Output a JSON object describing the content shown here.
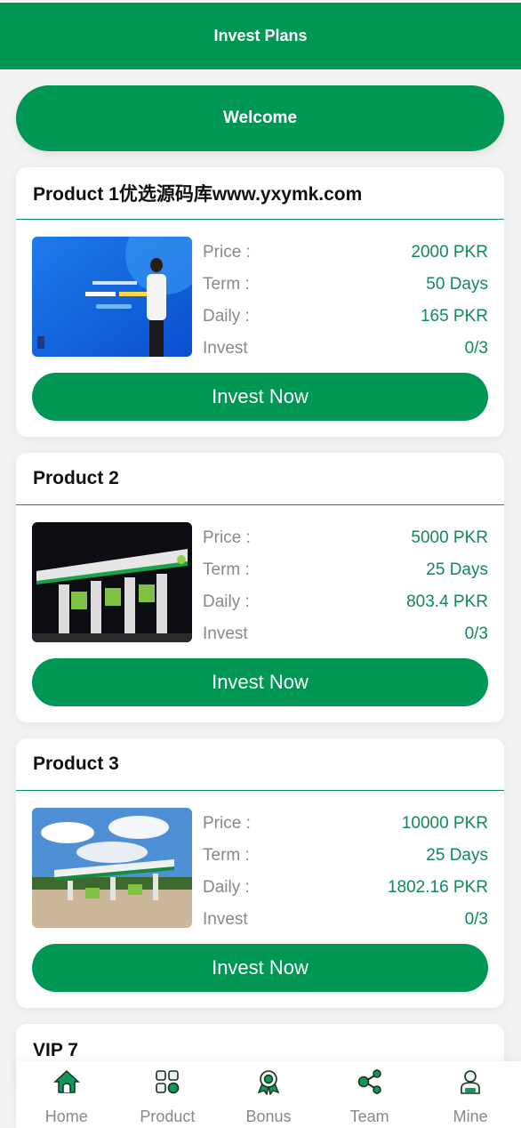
{
  "header": {
    "title": "Invest Plans"
  },
  "welcome_button": {
    "label": "Welcome"
  },
  "products": [
    {
      "title": "Product 1优选源码库www.yxymk.com",
      "image": "promo-banner-woman",
      "price_label": "Price :",
      "price_value": "2000 PKR",
      "term_label": "Term :",
      "term_value": "50 Days",
      "daily_label": "Daily :",
      "daily_value": "165 PKR",
      "invest_label": "Invest",
      "invest_value": "0/3",
      "button": "Invest Now"
    },
    {
      "title": "Product 2",
      "image": "gas-station-night",
      "price_label": "Price :",
      "price_value": "5000 PKR",
      "term_label": "Term :",
      "term_value": "25 Days",
      "daily_label": "Daily :",
      "daily_value": "803.4 PKR",
      "invest_label": "Invest",
      "invest_value": "0/3",
      "button": "Invest Now"
    },
    {
      "title": "Product 3",
      "image": "gas-station-day",
      "price_label": "Price :",
      "price_value": "10000 PKR",
      "term_label": "Term :",
      "term_value": "25 Days",
      "daily_label": "Daily :",
      "daily_value": "1802.16 PKR",
      "invest_label": "Invest",
      "invest_value": "0/3",
      "button": "Invest Now"
    },
    {
      "title": "VIP 7"
    }
  ],
  "tabbar": [
    {
      "label": "Home",
      "icon": "home-icon"
    },
    {
      "label": "Product",
      "icon": "grid-icon"
    },
    {
      "label": "Bonus",
      "icon": "award-icon"
    },
    {
      "label": "Team",
      "icon": "share-icon"
    },
    {
      "label": "Mine",
      "icon": "user-icon"
    }
  ],
  "colors": {
    "primary": "#009653",
    "value_text": "#0f8a55",
    "label_text": "#888888"
  }
}
